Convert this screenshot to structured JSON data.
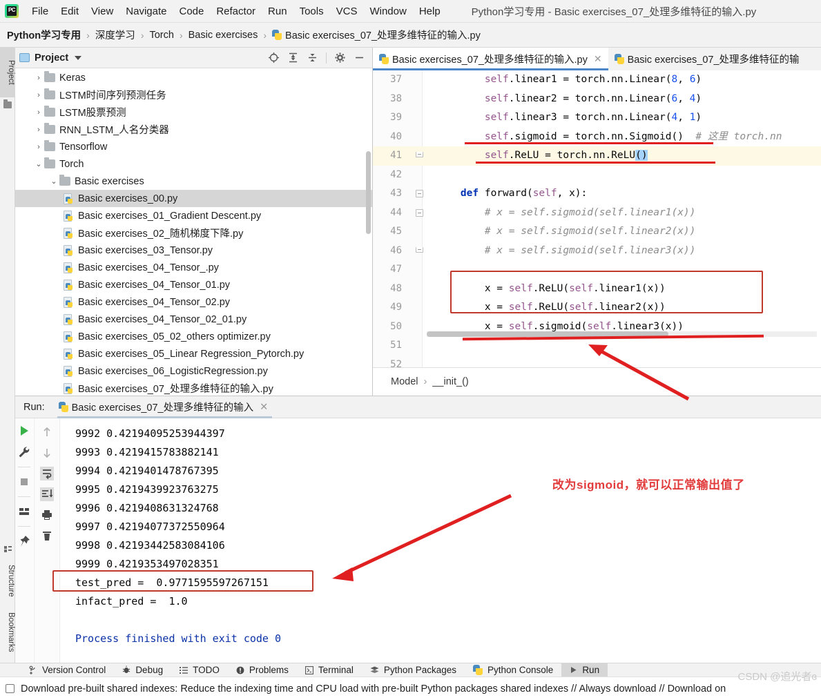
{
  "window": {
    "title": "Python学习专用 - Basic exercises_07_处理多维特征的输入.py",
    "logo_text": "PC"
  },
  "menubar": {
    "items": [
      {
        "label": "File"
      },
      {
        "label": "Edit"
      },
      {
        "label": "View"
      },
      {
        "label": "Navigate"
      },
      {
        "label": "Code"
      },
      {
        "label": "Refactor"
      },
      {
        "label": "Run"
      },
      {
        "label": "Tools"
      },
      {
        "label": "VCS"
      },
      {
        "label": "Window"
      },
      {
        "label": "Help"
      }
    ]
  },
  "breadcrumb": {
    "items": [
      {
        "label": "Python学习专用",
        "bold": true
      },
      {
        "label": "深度学习",
        "bold": false
      },
      {
        "label": "Torch",
        "bold": false
      },
      {
        "label": "Basic exercises",
        "bold": false
      },
      {
        "label": "Basic exercises_07_处理多维特征的输入.py",
        "bold": false,
        "icon": "python-file-icon"
      }
    ]
  },
  "left_rail": {
    "top": [
      {
        "label": "Project",
        "icon": "project-folder-icon",
        "active": true
      }
    ],
    "bottom": [
      {
        "label": "Structure",
        "icon": "structure-icon"
      },
      {
        "label": "Bookmarks",
        "icon": "bookmark-icon"
      }
    ]
  },
  "project_panel": {
    "title": "Project",
    "toolbar": [
      {
        "name": "locate-icon"
      },
      {
        "name": "expand-all-icon"
      },
      {
        "name": "collapse-all-icon"
      },
      {
        "name": "gear-icon"
      },
      {
        "name": "hide-icon"
      }
    ],
    "tree": [
      {
        "label": "Keras",
        "type": "folder",
        "indent": 1,
        "state": "collapsed"
      },
      {
        "label": "LSTM时间序列预测任务",
        "type": "folder",
        "indent": 1,
        "state": "collapsed"
      },
      {
        "label": "LSTM股票预测",
        "type": "folder",
        "indent": 1,
        "state": "collapsed"
      },
      {
        "label": "RNN_LSTM_人名分类器",
        "type": "folder",
        "indent": 1,
        "state": "collapsed"
      },
      {
        "label": "Tensorflow",
        "type": "folder",
        "indent": 1,
        "state": "collapsed"
      },
      {
        "label": "Torch",
        "type": "folder",
        "indent": 1,
        "state": "expanded"
      },
      {
        "label": "Basic exercises",
        "type": "folder",
        "indent": 2,
        "state": "expanded"
      },
      {
        "label": "Basic exercises_00.py",
        "type": "file",
        "indent": 3,
        "selected": true
      },
      {
        "label": "Basic exercises_01_Gradient Descent.py",
        "type": "file",
        "indent": 3
      },
      {
        "label": "Basic exercises_02_随机梯度下降.py",
        "type": "file",
        "indent": 3
      },
      {
        "label": "Basic exercises_03_Tensor.py",
        "type": "file",
        "indent": 3
      },
      {
        "label": "Basic exercises_04_Tensor_.py",
        "type": "file",
        "indent": 3
      },
      {
        "label": "Basic exercises_04_Tensor_01.py",
        "type": "file",
        "indent": 3
      },
      {
        "label": "Basic exercises_04_Tensor_02.py",
        "type": "file",
        "indent": 3
      },
      {
        "label": "Basic exercises_04_Tensor_02_01.py",
        "type": "file",
        "indent": 3
      },
      {
        "label": "Basic exercises_05_02_others optimizer.py",
        "type": "file",
        "indent": 3
      },
      {
        "label": "Basic exercises_05_Linear Regression_Pytorch.py",
        "type": "file",
        "indent": 3
      },
      {
        "label": "Basic exercises_06_LogisticRegression.py",
        "type": "file",
        "indent": 3
      },
      {
        "label": "Basic exercises_07_处理多维特征的输入.py",
        "type": "file",
        "indent": 3
      }
    ]
  },
  "editor": {
    "tabs": [
      {
        "label": "Basic exercises_07_处理多维特征的输入.py",
        "active": true,
        "closable": true
      },
      {
        "label": "Basic exercises_07_处理多维特征的输",
        "active": false,
        "closable": false
      }
    ],
    "breadcrumb_bottom": {
      "parent": "Model",
      "child": "__init_()",
      "separator": "›"
    },
    "lines": [
      {
        "n": "37",
        "indent": 8,
        "tokens": [
          {
            "t": "self",
            "c": "selfkw"
          },
          {
            "t": ".linear1 ",
            "c": "plain"
          },
          {
            "t": "= torch.nn.Linear(",
            "c": "plain"
          },
          {
            "t": "8",
            "c": "num"
          },
          {
            "t": ", ",
            "c": "plain"
          },
          {
            "t": "6",
            "c": "num"
          },
          {
            "t": ")",
            "c": "plain"
          }
        ]
      },
      {
        "n": "38",
        "indent": 8,
        "tokens": [
          {
            "t": "self",
            "c": "selfkw"
          },
          {
            "t": ".linear2 = torch.nn.Linear(",
            "c": "plain"
          },
          {
            "t": "6",
            "c": "num"
          },
          {
            "t": ", ",
            "c": "plain"
          },
          {
            "t": "4",
            "c": "num"
          },
          {
            "t": ")",
            "c": "plain"
          }
        ]
      },
      {
        "n": "39",
        "indent": 8,
        "tokens": [
          {
            "t": "self",
            "c": "selfkw"
          },
          {
            "t": ".linear3 = torch.nn.Linear(",
            "c": "plain"
          },
          {
            "t": "4",
            "c": "num"
          },
          {
            "t": ", ",
            "c": "plain"
          },
          {
            "t": "1",
            "c": "num"
          },
          {
            "t": ")",
            "c": "plain"
          }
        ]
      },
      {
        "n": "40",
        "indent": 8,
        "tokens": [
          {
            "t": "self",
            "c": "selfkw"
          },
          {
            "t": ".sigmoid = torch.nn.Sigmoid()",
            "c": "plain"
          },
          {
            "t": "  # 这里 torch.nn",
            "c": "cmt"
          }
        ]
      },
      {
        "n": "41",
        "indent": 8,
        "highlight": true,
        "fold": "end",
        "tokens": [
          {
            "t": "self",
            "c": "selfkw"
          },
          {
            "t": ".ReLU = torch.nn.ReLU",
            "c": "plain"
          },
          {
            "t": "()",
            "c": "plain sel-bg"
          }
        ]
      },
      {
        "n": "42",
        "indent": 0,
        "tokens": []
      },
      {
        "n": "43",
        "indent": 4,
        "fold": "start",
        "tokens": [
          {
            "t": "def ",
            "c": "kw"
          },
          {
            "t": "forward(",
            "c": "plain"
          },
          {
            "t": "self",
            "c": "selfkw"
          },
          {
            "t": ", x):",
            "c": "plain"
          }
        ]
      },
      {
        "n": "44",
        "indent": 8,
        "fold": "start",
        "tokens": [
          {
            "t": "# x = self.sigmoid(self.linear1(x))",
            "c": "cmt"
          }
        ]
      },
      {
        "n": "45",
        "indent": 8,
        "tokens": [
          {
            "t": "# x = self.sigmoid(self.linear2(x))",
            "c": "cmt"
          }
        ]
      },
      {
        "n": "46",
        "indent": 8,
        "fold": "end",
        "tokens": [
          {
            "t": "# x = self.sigmoid(self.linear3(x))",
            "c": "cmt"
          }
        ]
      },
      {
        "n": "47",
        "indent": 0,
        "tokens": []
      },
      {
        "n": "48",
        "indent": 8,
        "tokens": [
          {
            "t": "x = ",
            "c": "plain"
          },
          {
            "t": "self",
            "c": "selfkw"
          },
          {
            "t": ".ReLU(",
            "c": "plain"
          },
          {
            "t": "self",
            "c": "selfkw"
          },
          {
            "t": ".linear1(x))",
            "c": "plain"
          }
        ]
      },
      {
        "n": "49",
        "indent": 8,
        "tokens": [
          {
            "t": "x = ",
            "c": "plain"
          },
          {
            "t": "self",
            "c": "selfkw"
          },
          {
            "t": ".ReLU(",
            "c": "plain"
          },
          {
            "t": "self",
            "c": "selfkw"
          },
          {
            "t": ".linear2(x))",
            "c": "plain"
          }
        ]
      },
      {
        "n": "50",
        "indent": 8,
        "tokens": [
          {
            "t": "x = ",
            "c": "plain"
          },
          {
            "t": "self",
            "c": "selfkw"
          },
          {
            "t": ".sigmoid(",
            "c": "plain"
          },
          {
            "t": "self",
            "c": "selfkw"
          },
          {
            "t": ".linear3(x))",
            "c": "plain"
          }
        ]
      },
      {
        "n": "51",
        "indent": 0,
        "tokens": []
      },
      {
        "n": "52",
        "indent": 0,
        "tokens": []
      }
    ]
  },
  "run_panel": {
    "label": "Run:",
    "tab_label": "Basic exercises_07_处理多维特征的输入",
    "tab_icon": "python-icon",
    "toolbar_left": [
      {
        "name": "run-icon"
      },
      {
        "name": "wrench-icon"
      },
      {
        "name": "stop-icon"
      },
      {
        "name": "layout-icon"
      },
      {
        "name": "pin-icon"
      }
    ],
    "toolbar_right": [
      {
        "name": "arrow-up-icon"
      },
      {
        "name": "arrow-down-icon"
      },
      {
        "name": "soft-wrap-icon"
      },
      {
        "name": "scroll-to-end-icon"
      },
      {
        "name": "print-icon"
      },
      {
        "name": "trash-icon"
      }
    ],
    "console_lines": [
      {
        "text": "9992 0.42194095253944397",
        "style": "plain"
      },
      {
        "text": "9993 0.4219415783882141",
        "style": "plain"
      },
      {
        "text": "9994 0.4219401478767395",
        "style": "plain"
      },
      {
        "text": "9995 0.4219439923763275",
        "style": "plain"
      },
      {
        "text": "9996 0.4219408631324768",
        "style": "plain"
      },
      {
        "text": "9997 0.42194077372550964",
        "style": "plain"
      },
      {
        "text": "9998 0.42193442583084106",
        "style": "plain"
      },
      {
        "text": "9999 0.4219353497028351",
        "style": "plain"
      },
      {
        "text": "test_pred =  0.9771595597267151",
        "style": "plain",
        "boxed": true
      },
      {
        "text": "infact_pred =  1.0",
        "style": "plain"
      },
      {
        "text": "",
        "style": "plain"
      },
      {
        "text": "Process finished with exit code 0",
        "style": "blue"
      }
    ]
  },
  "annotations": {
    "note_text": "改为sigmoid，就可以正常输出值了",
    "color": "#e23b3b"
  },
  "toolwindow_bar": {
    "items": [
      {
        "label": "Version Control",
        "icon": "branch-icon",
        "active": false
      },
      {
        "label": "Debug",
        "icon": "bug-icon",
        "active": false
      },
      {
        "label": "TODO",
        "icon": "list-icon",
        "active": false
      },
      {
        "label": "Problems",
        "icon": "warning-icon",
        "active": false
      },
      {
        "label": "Terminal",
        "icon": "terminal-icon",
        "active": false
      },
      {
        "label": "Python Packages",
        "icon": "packages-icon",
        "active": false
      },
      {
        "label": "Python Console",
        "icon": "python-icon",
        "active": false
      },
      {
        "label": "Run",
        "icon": "run-icon",
        "active": true
      }
    ]
  },
  "statusbar": {
    "message": "Download pre-built shared indexes: Reduce the indexing time and CPU load with pre-built Python packages shared indexes // Always download // Download on"
  },
  "watermark": {
    "text": "CSDN @追光者ɞ"
  }
}
